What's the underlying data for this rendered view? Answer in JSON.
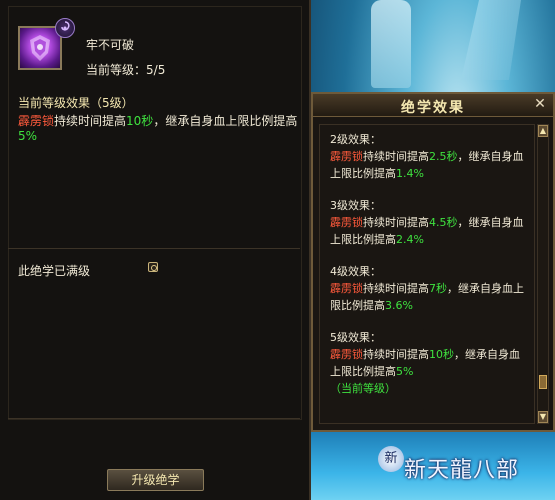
{
  "skill": {
    "name": "牢不可破",
    "level_label": "当前等级：",
    "level_value": "5/5",
    "icon": "skill-shield-icon",
    "badge_icon": "skill-type-badge-icon"
  },
  "current_effect": {
    "heading": "当前等级效果（5级）",
    "skill_ref": "霹雳锁",
    "text_a": "持续时间提高",
    "duration": "10秒",
    "text_b": "，继承自身血上限比例提高",
    "percent": "5%"
  },
  "maxed": {
    "label": "此绝学已满级",
    "icon": "info-icon"
  },
  "upgrade_button": "升级绝学",
  "popup": {
    "title": "绝学效果",
    "close": "✕",
    "levels": [
      {
        "title": "2级效果：",
        "skill_ref": "霹雳锁",
        "text_a": "持续时间提高",
        "duration": "2.5秒",
        "text_b": "，继承自身血上限比例提高",
        "percent": "1.4%"
      },
      {
        "title": "3级效果：",
        "skill_ref": "霹雳锁",
        "text_a": "持续时间提高",
        "duration": "4.5秒",
        "text_b": "，继承自身血上限比例提高",
        "percent": "2.4%"
      },
      {
        "title": "4级效果：",
        "skill_ref": "霹雳锁",
        "text_a": "持续时间提高",
        "duration": "7秒",
        "text_b": "，继承自身血上限比例提高",
        "percent": "3.6%"
      },
      {
        "title": "5级效果：",
        "skill_ref": "霹雳锁",
        "text_a": "持续时间提高",
        "duration": "10秒",
        "text_b": "，继承自身血上限比例提高",
        "percent": "5%",
        "current": "（当前等级）"
      }
    ]
  },
  "logo": {
    "text": "新天龍八部",
    "mark": "新"
  },
  "colors": {
    "skill_ref": "#ff5a3c",
    "value": "#3fe23f",
    "heading": "#f4e7b0",
    "frame": "#6e5a3a"
  }
}
